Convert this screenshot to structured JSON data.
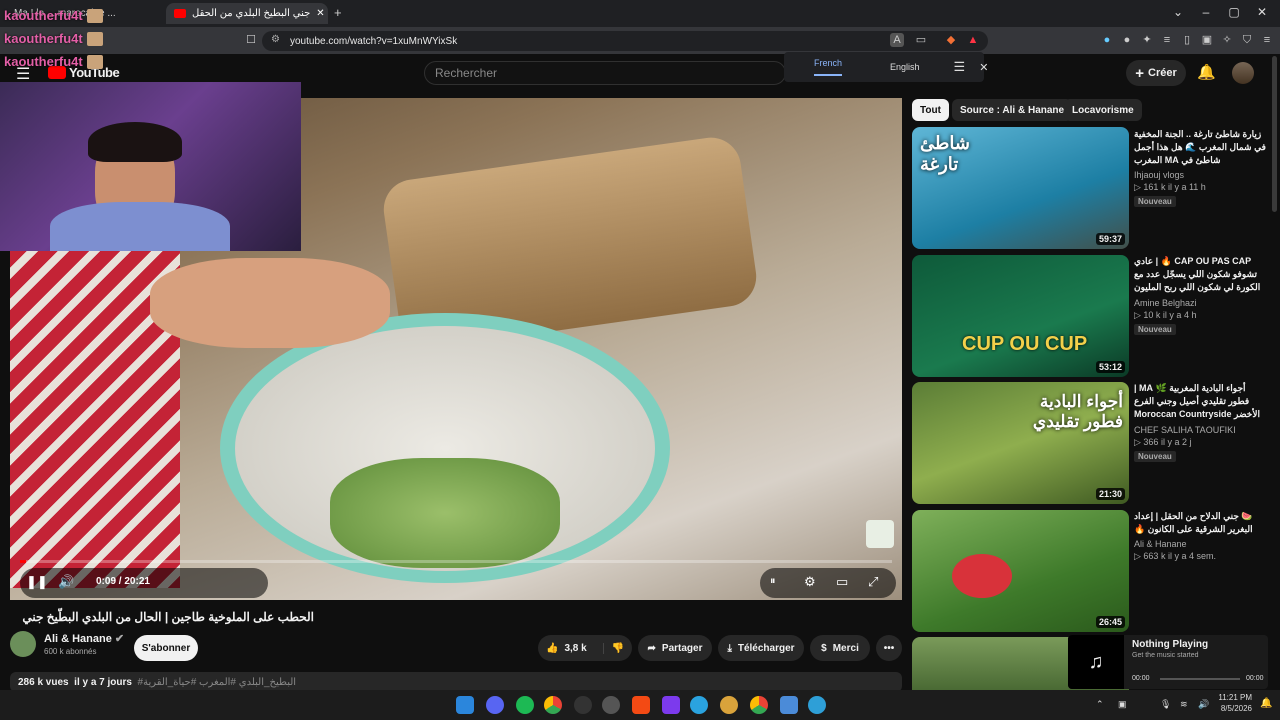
{
  "browser": {
    "tabs": [
      {
        "label": "Ma ! le ... marocaine ..."
      },
      {
        "label": "جني البطيخ البلدي من الحقل"
      }
    ],
    "new_tab": "+",
    "url": "youtube.com/watch?v=1xuMnWYixSk"
  },
  "chat_overlay": [
    "kaoutherfu4t",
    "kaoutherfu4t",
    "kaoutherfu4t"
  ],
  "youtube": {
    "logo": "YouTube",
    "search_placeholder": "Rechercher",
    "create_label": "Créer"
  },
  "translate": {
    "lang1": "French",
    "lang2": "English"
  },
  "player": {
    "time_current": "0:09",
    "time_total": "20:21",
    "progress": 0.0074
  },
  "video": {
    "title": "الحطب على الملوخية طاجين | الحال من البلدي البطّيخ جني",
    "channel": "Ali & Hanane",
    "subscribers": "600 k abonnés",
    "subscribe": "S'abonner",
    "likes": "3,8 k",
    "share": "Partager",
    "download": "Télécharger",
    "thanks": "Merci",
    "views": "286 k vues",
    "date": "il y a 7 jours",
    "hashtags": "#البطيخ_البلدي #المغرب #حياة_القرية"
  },
  "chips": [
    "Tout",
    "Source : Ali & Hanane",
    "Locavorisme"
  ],
  "recommendations": [
    {
      "title": "زيارة شاطئ تارغة .. الجنة المخفية في شمال المغرب 🌊 هل هذا أجمل شاطئ في MA المغرب",
      "channel": "Ihjaouj vlogs",
      "meta": "▷ 161 k  il y a 11 h",
      "badge": "Nouveau",
      "duration": "59:37",
      "thumb_text": "شاطئ تارغة"
    },
    {
      "title": "CAP OU PAS CAP 🔥 | عادي تشوفو شكون اللي يسجّل عدد مع الكورة لي شكون اللي ربح المليون 💰🏆",
      "channel": "Amine Belghazi",
      "meta": "▷ 10 k  il y a 4 h",
      "badge": "Nouveau",
      "duration": "53:12",
      "thumb_text": "CUP OU CUP"
    },
    {
      "title": "أجواء البادية المغربية 🌿 MA | فطور تقليدي أصيل وجني الفرع الأخضر Moroccan Countryside Life",
      "channel": "CHEF SALIHA TAOUFIKI",
      "meta": "▷ 366  il y a 2 j",
      "badge": "Nouveau",
      "duration": "21:30",
      "thumb_text": "أجواء البادية فطور تقليدي"
    },
    {
      "title": "🍉 جني الدلاح من الحقل | إعداد البغرير الشرقية على الكانون 🔥",
      "channel": "Ali & Hanane",
      "meta": "▷ 663 k  il y a 4 sem.",
      "badge": "",
      "duration": "26:45",
      "thumb_text": ""
    }
  ],
  "music_widget": {
    "title": "Nothing Playing",
    "subtitle": "Get the music started",
    "t_start": "00:00",
    "t_end": "00:00"
  },
  "taskbar": {
    "time": "11:21 PM",
    "date": "8/5/2026"
  },
  "colors": {
    "youtube_red": "#ff0000",
    "chat_name": "#e35fa7",
    "chip_active_bg": "#f1f1f1"
  }
}
